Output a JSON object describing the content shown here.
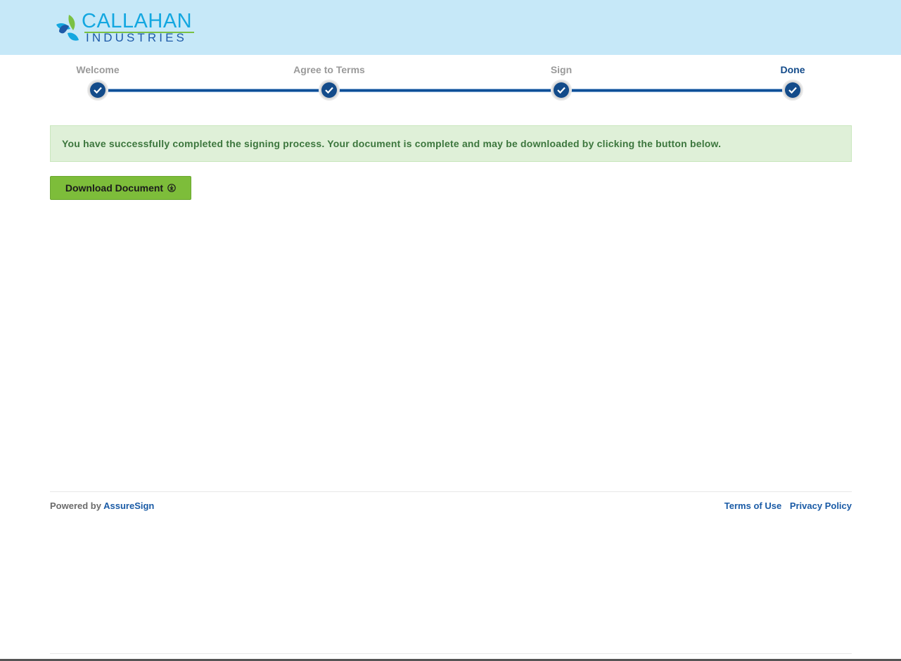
{
  "brand": {
    "line1": "CALLAHAN",
    "line2": "INDUSTRIES",
    "colors": {
      "header_bg": "#c6e8f8",
      "primary": "#134b8a",
      "accent_green": "#7ac143"
    }
  },
  "steps": [
    {
      "label": "Welcome",
      "status": "complete",
      "icon": "check-icon"
    },
    {
      "label": "Agree to Terms",
      "status": "complete",
      "icon": "check-icon"
    },
    {
      "label": "Sign",
      "status": "complete",
      "icon": "check-icon"
    },
    {
      "label": "Done",
      "status": "current",
      "icon": "check-icon"
    }
  ],
  "alert": {
    "message": "You have successfully completed the signing process. Your document is complete and may be downloaded by clicking the button below."
  },
  "download": {
    "label": "Download Document",
    "icon": "download-icon"
  },
  "footer": {
    "powered_prefix": "Powered by",
    "powered_link": "AssureSign",
    "terms": "Terms of Use",
    "privacy": "Privacy Policy"
  }
}
